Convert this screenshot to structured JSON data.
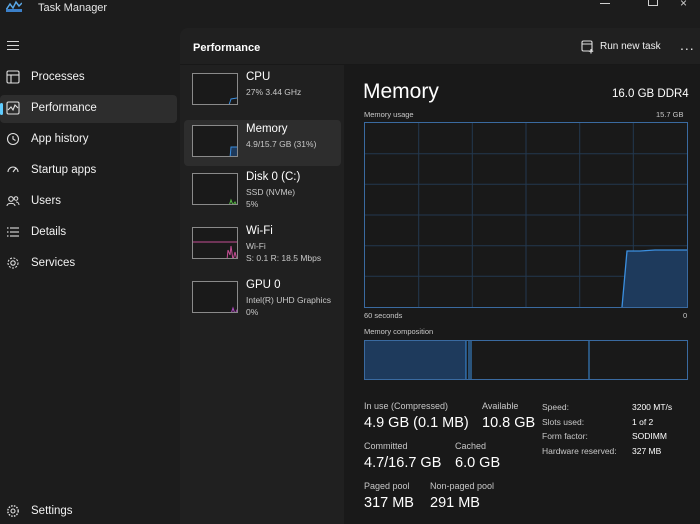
{
  "window": {
    "title": "Task Manager",
    "close_glyph": "×"
  },
  "nav": {
    "items": [
      {
        "label": "Processes",
        "icon": "processes-icon"
      },
      {
        "label": "Performance",
        "icon": "performance-icon",
        "active": true
      },
      {
        "label": "App history",
        "icon": "app-history-icon"
      },
      {
        "label": "Startup apps",
        "icon": "startup-apps-icon"
      },
      {
        "label": "Users",
        "icon": "users-icon"
      },
      {
        "label": "Details",
        "icon": "details-icon"
      },
      {
        "label": "Services",
        "icon": "services-icon"
      }
    ],
    "settings": "Settings"
  },
  "header": {
    "title": "Performance",
    "run_new_task": "Run new task",
    "more": "..."
  },
  "devices": [
    {
      "name": "CPU",
      "sub1": "27%  3.44 GHz",
      "sub2": ""
    },
    {
      "name": "Memory",
      "sub1": "4.9/15.7 GB (31%)",
      "sub2": ""
    },
    {
      "name": "Disk 0 (C:)",
      "sub1": "SSD (NVMe)",
      "sub2": "5%"
    },
    {
      "name": "Wi-Fi",
      "sub1": "Wi-Fi",
      "sub2": "S: 0.1  R: 18.5 Mbps"
    },
    {
      "name": "GPU 0",
      "sub1": "Intel(R) UHD Graphics",
      "sub2": "0%"
    }
  ],
  "detail": {
    "title": "Memory",
    "spec": "16.0 GB DDR4",
    "usage_label": "Memory usage",
    "usage_max": "15.7 GB",
    "time_left": "60 seconds",
    "time_right": "0",
    "composition_label": "Memory composition",
    "stats": {
      "in_use_label": "In use (Compressed)",
      "in_use_value": "4.9 GB (0.1 MB)",
      "available_label": "Available",
      "available_value": "10.8 GB",
      "committed_label": "Committed",
      "committed_value": "4.7/16.7 GB",
      "cached_label": "Cached",
      "cached_value": "6.0 GB",
      "paged_label": "Paged pool",
      "paged_value": "317 MB",
      "nonpaged_label": "Non-paged pool",
      "nonpaged_value": "291 MB"
    },
    "specs": {
      "speed_label": "Speed:",
      "speed_value": "3200 MT/s",
      "slots_label": "Slots used:",
      "slots_value": "1 of 2",
      "form_label": "Form factor:",
      "form_value": "SODIMM",
      "reserved_label": "Hardware reserved:",
      "reserved_value": "327 MB"
    }
  },
  "colors": {
    "accent": "#60cdff",
    "memory_line": "#3b8fe0",
    "memory_fill": "#1e3a5c",
    "disk_green": "#59b947",
    "wifi_pink": "#c44e94",
    "gpu_purple": "#b04bc0"
  }
}
